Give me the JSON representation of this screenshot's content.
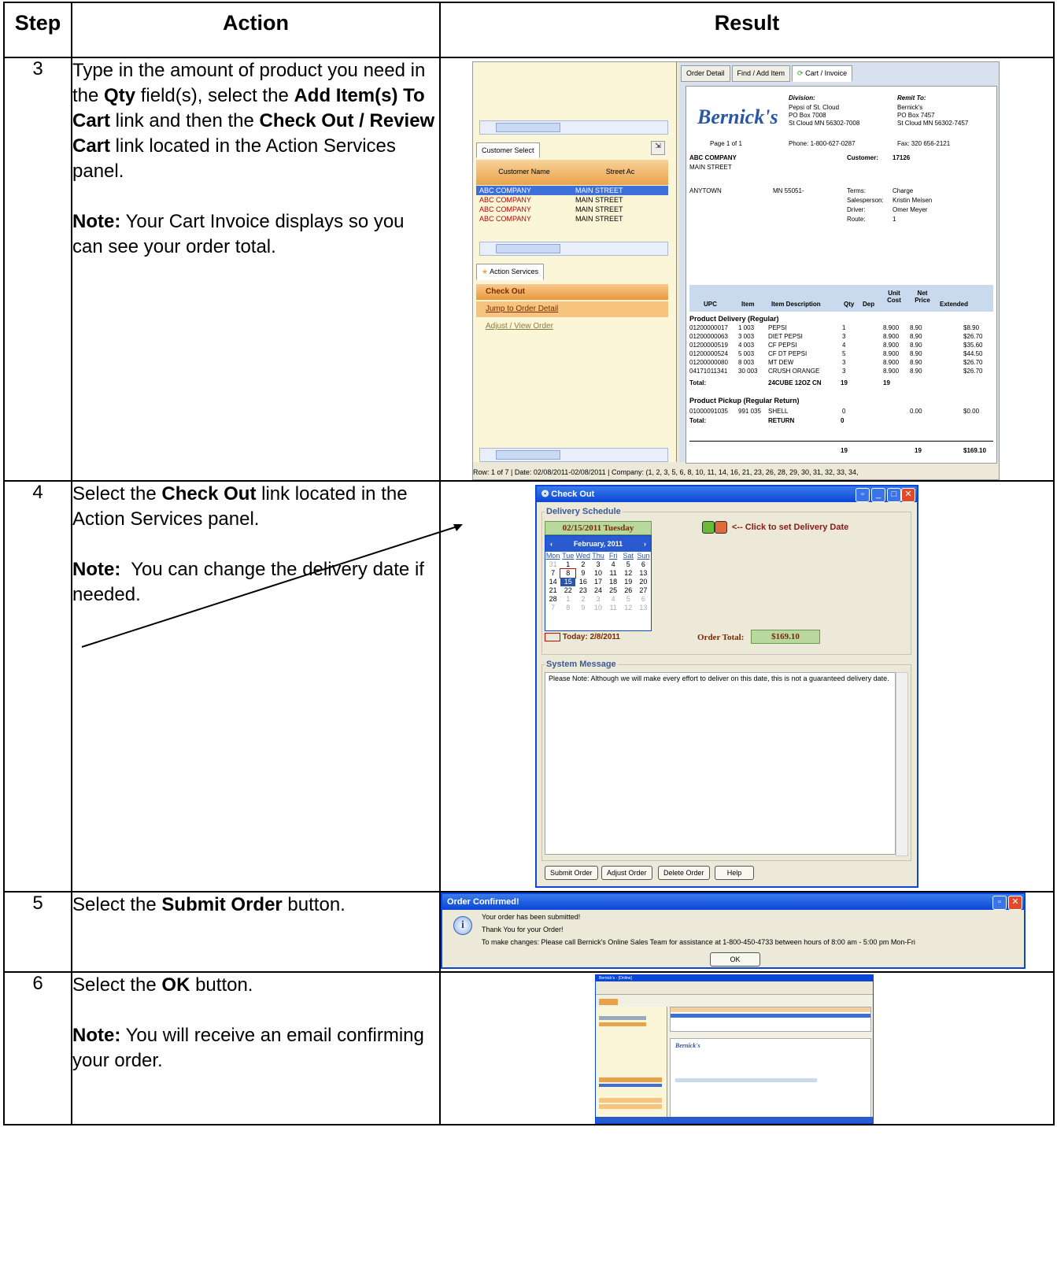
{
  "table": {
    "headers": {
      "step": "Step",
      "action": "Action",
      "result": "Result"
    },
    "rows": [
      {
        "step": "3",
        "action_html": "Type in the amount of product you need in the <b>Qty</b> field(s), select the <b>Add Item(s) To Cart</b> link and then the <b>Check Out / Review Cart</b> link located in the Action Services panel.",
        "note_html": "<b>Note:</b> Your Cart Invoice displays so you can see your order total."
      },
      {
        "step": "4",
        "action_html": "Select the <b>Check Out</b> link located in the Action Services panel.",
        "note_html": "<b>Note:</b>&nbsp; You can change the delivery date if needed."
      },
      {
        "step": "5",
        "action_html": "Select the <b>Submit Order</b> button.",
        "note_html": ""
      },
      {
        "step": "6",
        "action_html": "Select the <b>OK</b> button.",
        "note_html": "<b>Note:</b> You will receive an email confirming your order."
      }
    ]
  },
  "shot3": {
    "customer_tab": "Customer Select",
    "grid_headers": [
      "Customer Name",
      "Street Ac"
    ],
    "grid_rows": [
      [
        "ABC COMPANY",
        "MAIN STREET"
      ],
      [
        "ABC COMPANY",
        "MAIN STREET"
      ],
      [
        "ABC COMPANY",
        "MAIN STREET"
      ],
      [
        "ABC COMPANY",
        "MAIN STREET"
      ]
    ],
    "actions_tab": "Action Services",
    "actions": [
      "Check Out",
      "Jump to Order Detail",
      "Adjust / View Order"
    ],
    "tabs": [
      "Order Detail",
      "Find / Add Item",
      "Cart / Invoice"
    ],
    "invoice": {
      "logo": "Bernick's",
      "division_label": "Division:",
      "division": [
        "Pepsi of St. Cloud",
        "PO Box 7008",
        "St Cloud MN 56302-7008"
      ],
      "remit_label": "Remit To:",
      "remit": [
        "Bernick's",
        "PO Box 7457",
        "St Cloud MN 56302-7457"
      ],
      "page": "Page 1 of 1",
      "phone": "Phone: 1-800-627-0287",
      "fax": "Fax: 320 656-2121",
      "company": "ABC COMPANY",
      "street": "MAIN STREET",
      "customer_label": "Customer:",
      "customer_no": "17126",
      "town": "ANYTOWN",
      "state_zip": "MN 55051-",
      "terms_label": "Terms:",
      "terms": "Charge",
      "salesperson_label": "Salesperson:",
      "salesperson": "Kristin Meisen",
      "driver_label": "Driver:",
      "driver": "Omer Meyer",
      "route_label": "Route:",
      "route": "1",
      "columns": [
        "UPC",
        "Item",
        "Item Description",
        "Qty",
        "Dep",
        "Unit Cost",
        "Net Price",
        "Extended"
      ],
      "section1": "Product Delivery (Regular)",
      "lines": [
        [
          "01200000017",
          "1 003",
          "PEPSI",
          "1",
          "",
          "8.900",
          "8.90",
          "$8.90"
        ],
        [
          "01200000063",
          "3 003",
          "DIET PEPSI",
          "3",
          "",
          "8.900",
          "8.90",
          "$26.70"
        ],
        [
          "01200000519",
          "4 003",
          "CF PEPSI",
          "4",
          "",
          "8.900",
          "8.90",
          "$35.60"
        ],
        [
          "01200000524",
          "5 003",
          "CF DT PEPSI",
          "5",
          "",
          "8.900",
          "8.90",
          "$44.50"
        ],
        [
          "01200000080",
          "8 003",
          "MT DEW",
          "3",
          "",
          "8.900",
          "8.90",
          "$26.70"
        ],
        [
          "04171011341",
          "30 003",
          "CRUSH ORANGE",
          "3",
          "",
          "8.900",
          "8.90",
          "$26.70"
        ]
      ],
      "total1_label": "Total:",
      "total1_desc": "24CUBE 12OZ CN",
      "total1_qty": "19",
      "total1_dep": "19",
      "section2": "Product Pickup (Regular Return)",
      "pickup": [
        "01000091035",
        "991 035",
        "SHELL",
        "0",
        "",
        "",
        "0.00",
        "$0.00"
      ],
      "total2_label": "Total:",
      "total2_desc": "RETURN",
      "total2_qty": "0",
      "grand_qty": "19",
      "grand_dep": "19",
      "grand_total": "$169.10"
    },
    "status": "Row: 1 of 7 | Date: 02/08/2011-02/08/2011 | Company: (1, 2, 3, 5, 6, 8, 10, 11, 14, 16, 21, 23, 26, 28, 29, 30, 31, 32, 33, 34,"
  },
  "shot4": {
    "title": "Check Out",
    "delivery_label": "Delivery Schedule",
    "date_value": "02/15/2011 Tuesday",
    "hint": "<-- Click to set Delivery Date",
    "month": "February, 2011",
    "weekdays": [
      "Mon",
      "Tue",
      "Wed",
      "Thu",
      "Fri",
      "Sat",
      "Sun"
    ],
    "days": [
      "31",
      "1",
      "2",
      "3",
      "4",
      "5",
      "6",
      "7",
      "8",
      "9",
      "10",
      "11",
      "12",
      "13",
      "14",
      "15",
      "16",
      "17",
      "18",
      "19",
      "20",
      "21",
      "22",
      "23",
      "24",
      "25",
      "26",
      "27",
      "28",
      "1",
      "2",
      "3",
      "4",
      "5",
      "6",
      "7",
      "8",
      "9",
      "10",
      "11",
      "12",
      "13"
    ],
    "today": "Today: 2/8/2011",
    "order_total_label": "Order Total:",
    "order_total": "$169.10",
    "system_label": "System Message",
    "message": "Please Note: Although we will make every effort to deliver on this date, this is not a guaranteed delivery date.",
    "buttons": [
      "Submit Order",
      "Adjust Order",
      "Delete Order",
      "Help"
    ]
  },
  "shot5": {
    "title": "Order Confirmed!",
    "line1": "Your order has been submitted!",
    "line2": "Thank You for your Order!",
    "line3": "To make changes: Please call Bernick's Online Sales Team for assistance at 1-800-450-4733 between hours of 8:00 am - 5:00 pm Mon-Fri",
    "ok": "OK"
  },
  "shot6": {
    "title": "Bernick's - [Online]",
    "logo": "Bernick's"
  },
  "colors": {
    "xp_blue": "#0a46d8",
    "orange": "#e9a24b",
    "select_blue": "#3d6fd8"
  }
}
